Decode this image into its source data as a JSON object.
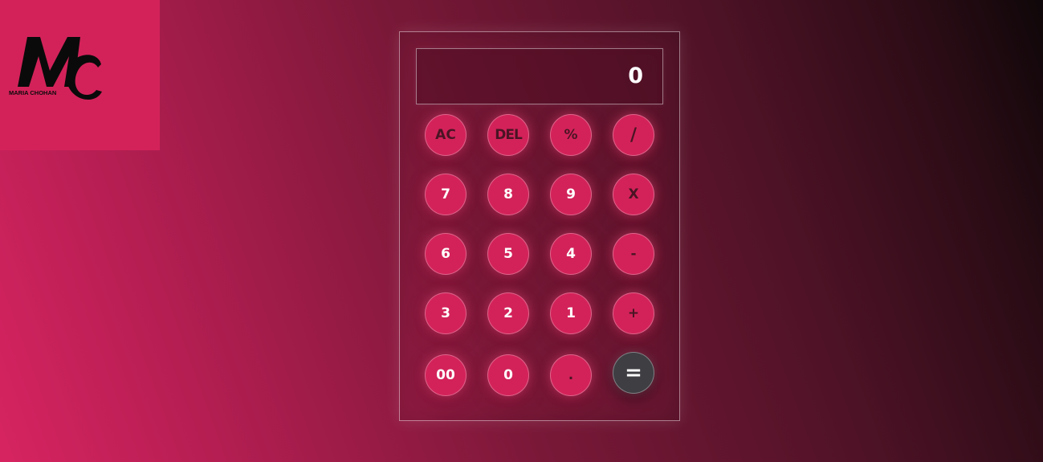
{
  "logo": {
    "letters": "MC",
    "caption": "MARIA CHOHAN"
  },
  "display": {
    "value": "0"
  },
  "buttons": {
    "ac": "AC",
    "del": "DEL",
    "percent": "%",
    "divide": "/",
    "seven": "7",
    "eight": "8",
    "nine": "9",
    "multiply": "X",
    "six": "6",
    "five": "5",
    "four": "4",
    "minus": "-",
    "three": "3",
    "two": "2",
    "one": "1",
    "plus": "+",
    "double_zero": "00",
    "zero": "0",
    "dot": ".",
    "equals": "="
  },
  "colors": {
    "button": "#d3225a",
    "equals_button": "#3e3e43",
    "logo_bg": "#d3225a"
  }
}
